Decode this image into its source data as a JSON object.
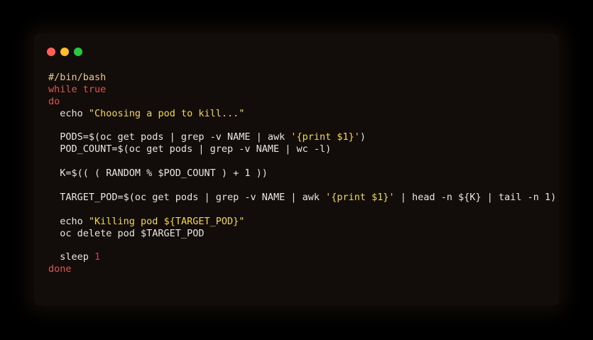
{
  "colors": {
    "page_background": "#000000",
    "window_background": "#120c0a",
    "default_text": "#e8e6e3",
    "comment": "#e8c98a",
    "keyword": "#e0554f",
    "string": "#f2d94e",
    "number": "#c9406b"
  },
  "window_controls": [
    {
      "name": "close",
      "color": "#ff5f57"
    },
    {
      "name": "minimize",
      "color": "#febc2e"
    },
    {
      "name": "maximize",
      "color": "#28c840"
    }
  ],
  "code": {
    "language": "bash",
    "lines": [
      [
        {
          "t": "#/bin/bash",
          "k": "comment"
        }
      ],
      [
        {
          "t": "while",
          "k": "keyword"
        },
        {
          "t": " true",
          "k": "keyword"
        }
      ],
      [
        {
          "t": "do",
          "k": "keyword"
        }
      ],
      [
        {
          "t": "  echo ",
          "k": "plain"
        },
        {
          "t": "\"Choosing a pod to kill...\"",
          "k": "string"
        }
      ],
      [],
      [
        {
          "t": "  PODS=$(oc get pods | grep -v NAME | awk ",
          "k": "plain"
        },
        {
          "t": "'{print $1}'",
          "k": "string"
        },
        {
          "t": ")",
          "k": "plain"
        }
      ],
      [
        {
          "t": "  POD_COUNT=$(oc get pods | grep -v NAME | wc -l)",
          "k": "plain"
        }
      ],
      [],
      [
        {
          "t": "  K=$(( ( RANDOM % $POD_COUNT ) + 1 ))",
          "k": "plain"
        }
      ],
      [],
      [
        {
          "t": "  TARGET_POD=$(oc get pods | grep -v NAME | awk ",
          "k": "plain"
        },
        {
          "t": "'{print $1}'",
          "k": "string"
        },
        {
          "t": " | head -n ${K} | tail -n 1)",
          "k": "plain"
        }
      ],
      [],
      [
        {
          "t": "  echo ",
          "k": "plain"
        },
        {
          "t": "\"Killing pod ${TARGET_POD}\"",
          "k": "string"
        }
      ],
      [
        {
          "t": "  oc delete pod $TARGET_POD",
          "k": "plain"
        }
      ],
      [],
      [
        {
          "t": "  sleep ",
          "k": "plain"
        },
        {
          "t": "1",
          "k": "number"
        }
      ],
      [
        {
          "t": "done",
          "k": "keyword"
        }
      ]
    ]
  }
}
